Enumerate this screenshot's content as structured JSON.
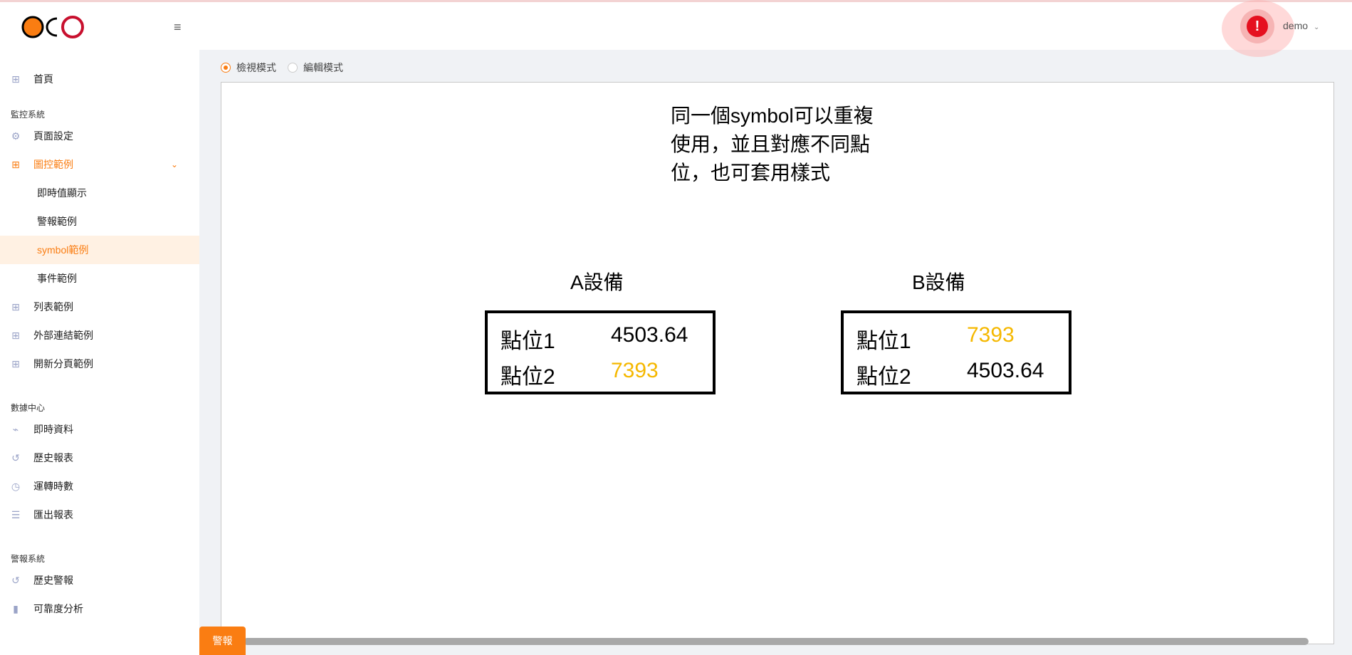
{
  "sidebar": {
    "logo_text": "OCO",
    "home": "首頁",
    "sections": [
      "監控系統",
      "數據中心",
      "警報系統"
    ],
    "monitor_items": {
      "page_settings": "頁面設定",
      "graphic_examples": "圖控範例",
      "realtime_display": "即時值顯示",
      "alarm_example": "警報範例",
      "symbol_example": "symbol範例",
      "event_example": "事件範例",
      "list_example": "列表範例",
      "external_link_example": "外部連結範例",
      "new_tab_example": "開新分頁範例"
    },
    "data_items": {
      "realtime_data": "即時資料",
      "history_report": "歷史報表",
      "runtime_count": "運轉時數",
      "export_report": "匯出報表"
    },
    "alarm_items": {
      "history_alarm": "歷史警報",
      "reliability_analysis": "可靠度分析"
    }
  },
  "header": {
    "alert_icon": "!",
    "user": "demo"
  },
  "modes": {
    "view": "檢視模式",
    "edit": "編輯模式",
    "selected": "view"
  },
  "canvas": {
    "note_lines": [
      "同一個symbol可以重複",
      "使用，並且對應不同點",
      "位，也可套用樣式"
    ],
    "devices": [
      {
        "title": "A設備",
        "points": [
          {
            "label": "點位1",
            "value": "4503.64"
          },
          {
            "label": "點位2",
            "value": "7393"
          }
        ]
      },
      {
        "title": "B設備",
        "points": [
          {
            "label": "點位1",
            "value": "7393"
          },
          {
            "label": "點位2",
            "value": "4503.64"
          }
        ]
      }
    ]
  },
  "alarm_tab": "警報",
  "colors": {
    "accent": "#fa7d12",
    "highlight_value": "#f5b800",
    "alert_red": "#e5101f"
  }
}
